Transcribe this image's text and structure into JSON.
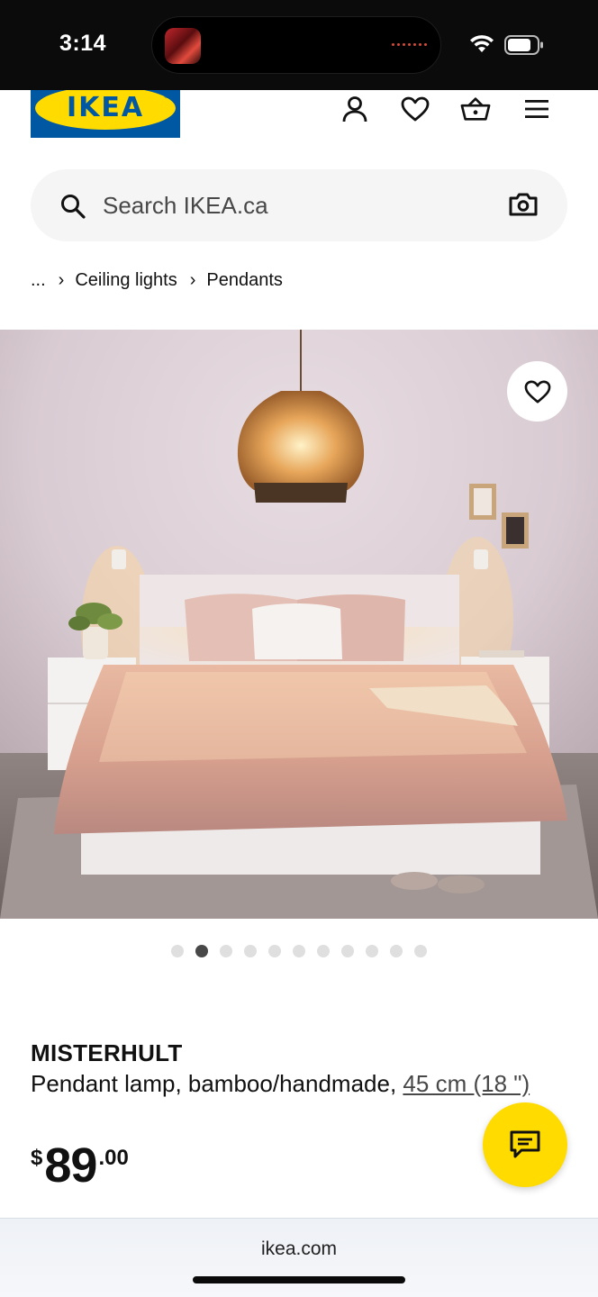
{
  "status_bar": {
    "time": "3:14"
  },
  "header": {
    "logo_text": "IKEA",
    "logo_reg": "®",
    "icons": [
      "account-icon",
      "heart-icon",
      "basket-icon",
      "menu-icon"
    ]
  },
  "search": {
    "placeholder": "Search IKEA.ca"
  },
  "breadcrumb": {
    "ellipsis": "...",
    "items": [
      "Ceiling lights",
      "Pendants"
    ]
  },
  "carousel": {
    "total": 11,
    "active_index": 1
  },
  "product": {
    "name": "MISTERHULT",
    "description": "Pendant lamp, bamboo/handmade,",
    "size": "45 cm (18 \")",
    "price_currency": "$",
    "price_integer": "89",
    "price_decimal": ".00"
  },
  "browser": {
    "url": "ikea.com"
  },
  "colors": {
    "ikea_blue": "#0058a3",
    "ikea_yellow": "#ffdb00",
    "search_bg": "#f5f5f5"
  }
}
